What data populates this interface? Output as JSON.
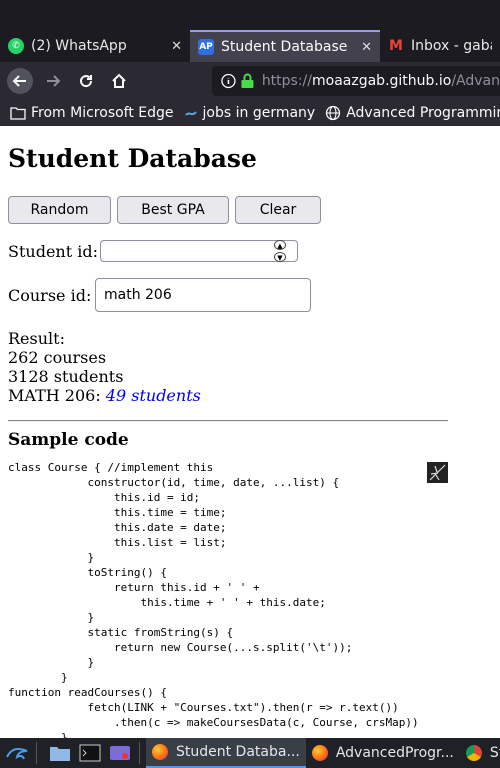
{
  "browser": {
    "tabs": [
      {
        "label": "(2) WhatsApp",
        "icon": "whatsapp-icon"
      },
      {
        "label": "Student Database",
        "icon": "ap-icon"
      },
      {
        "label": "Inbox - gaball",
        "icon": "gmail-icon"
      }
    ],
    "url_prefix": "https://",
    "url_host": "moaazgab.github.io",
    "url_path": "/Advan",
    "bookmarks": [
      {
        "label": "From Microsoft Edge",
        "icon": "folder-icon"
      },
      {
        "label": "jobs in germany",
        "icon": "link-icon"
      },
      {
        "label": "Advanced Programmin...",
        "icon": "globe-icon"
      }
    ]
  },
  "page": {
    "title": "Student Database",
    "buttons": {
      "random": "Random",
      "best_gpa": "Best GPA",
      "clear": "Clear"
    },
    "student_id_label": "Student id:",
    "student_id_value": "",
    "course_id_label": "Course id:",
    "course_id_value": "math 206",
    "result": {
      "label": "Result:",
      "courses": "262 courses",
      "students": "3128 students",
      "course_prefix": "MATH 206:",
      "course_link": "49 students"
    },
    "sample_heading": "Sample code",
    "code": "class Course { //implement this\n            constructor(id, time, date, ...list) {\n                this.id = id;\n                this.time = time;\n                this.date = date;\n                this.list = list;\n            }\n            toString() {\n                return this.id + ' ' +\n                    this.time + ' ' + this.date;\n            }\n            static fromString(s) {\n                return new Course(...s.split('\\t'));\n            }\n        }\nfunction readCourses() {\n            fetch(LINK + \"Courses.txt\").then(r => r.text())\n                .then(c => makeCoursesData(c, Course, crsMap))\n        }"
  },
  "taskbar": {
    "tasks": [
      {
        "label": "Student Databa...",
        "icon": "firefox-icon"
      },
      {
        "label": "AdvancedProgr...",
        "icon": "firefox-icon"
      },
      {
        "label": "Stu",
        "icon": "chrome-icon"
      }
    ]
  },
  "colors": {
    "link": "#0000ee",
    "tab_accent": "#9e97f5",
    "chrome_dark": "#1c1b22"
  }
}
